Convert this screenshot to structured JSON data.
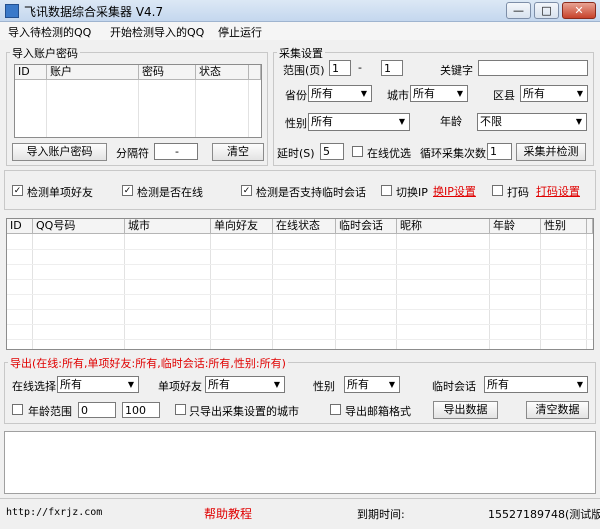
{
  "window": {
    "title": "飞讯数据综合采集器 V4.7",
    "min_label": "—",
    "max_label": "□",
    "close_label": "✕"
  },
  "menu": [
    "导入待检测的QQ",
    "开始检测导入的QQ",
    "停止运行"
  ],
  "import_group": {
    "title": "导入账户密码",
    "columns": [
      "ID",
      "账户",
      "密码",
      "状态"
    ],
    "import_button": "导入账户密码",
    "separator_label": "分隔符",
    "separator_value": "-",
    "clear_button": "清空"
  },
  "collect_group": {
    "title": "采集设置",
    "range_label": "范围(页)",
    "range_from": "1",
    "range_dash": "-",
    "range_to": "1",
    "keyword_label": "关键字",
    "keyword_value": "",
    "province_label": "省份",
    "province_value": "所有",
    "city_label": "城市",
    "city_value": "所有",
    "district_label": "区县",
    "district_value": "所有",
    "gender_label": "性别",
    "gender_value": "所有",
    "age_label": "年龄",
    "age_value": "不限",
    "delay_label": "延时(S)",
    "delay_value": "5",
    "online_first_label": "在线优选",
    "loop_label": "循环采集次数",
    "loop_value": "1",
    "collect_button": "采集并检测"
  },
  "options": {
    "check_single_friend": "检测单项好友",
    "check_online": "检测是否在线",
    "check_temp_chat": "检测是否支持临时会话",
    "switch_ip": "切换IP",
    "switch_ip_link": "换IP设置",
    "captcha": "打码",
    "captcha_link": "打码设置"
  },
  "results_table": {
    "columns": [
      "ID",
      "QQ号码",
      "城市",
      "单向好友",
      "在线状态",
      "临时会话",
      "昵称",
      "年龄",
      "性别"
    ]
  },
  "export_group": {
    "title": "导出(在线:所有,单项好友:所有,临时会话:所有,性别:所有)",
    "online_label": "在线选择",
    "online_value": "所有",
    "single_friend_label": "单项好友",
    "single_friend_value": "所有",
    "gender_label": "性别",
    "gender_value": "所有",
    "temp_chat_label": "临时会话",
    "temp_chat_value": "所有",
    "age_range_label": "年龄范围",
    "age_min": "0",
    "age_max": "100",
    "only_city_label": "只导出采集设置的城市",
    "email_format_label": "导出邮箱格式",
    "export_button": "导出数据",
    "clear_button": "清空数据"
  },
  "status": {
    "url": "http://fxrjz.com",
    "help": "帮助教程",
    "expire_label": "到期时间:",
    "version_info": "15527189748(测试版)"
  }
}
